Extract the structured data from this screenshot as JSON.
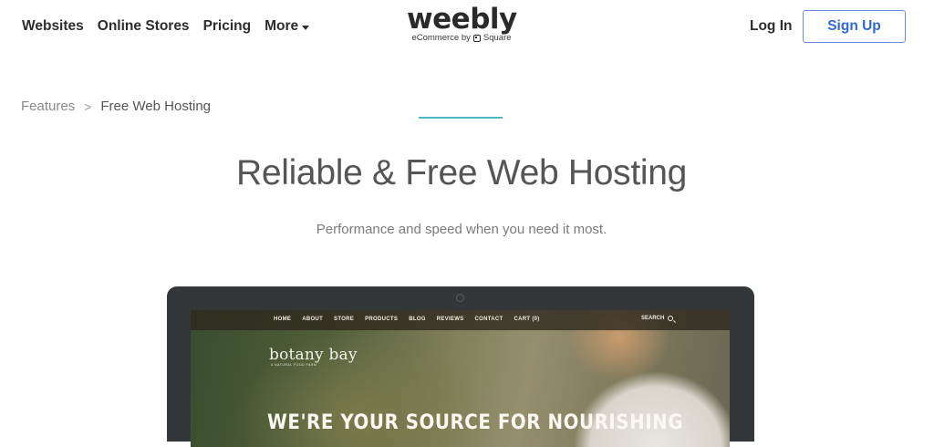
{
  "nav": {
    "items": [
      {
        "label": "Websites"
      },
      {
        "label": "Online Stores"
      },
      {
        "label": "Pricing"
      },
      {
        "label": "More"
      }
    ],
    "more_icon": "chevron-down-icon"
  },
  "logo": {
    "wordmark": "weebly",
    "tagline_prefix": "eCommerce by",
    "tagline_brand": "Square",
    "brand_icon": "square-logo-icon"
  },
  "header_actions": {
    "login_label": "Log In",
    "signup_label": "Sign Up"
  },
  "breadcrumb": {
    "parent": "Features",
    "separator": ">",
    "current": "Free Web Hosting"
  },
  "hero": {
    "title": "Reliable & Free Web Hosting",
    "subtitle": "Performance and speed when you need it most.",
    "accent_color": "#4cb8c4"
  },
  "mockup": {
    "nav_items": [
      {
        "label": "HOME"
      },
      {
        "label": "ABOUT"
      },
      {
        "label": "STORE"
      },
      {
        "label": "PRODUCTS"
      },
      {
        "label": "BLOG"
      },
      {
        "label": "REVIEWS"
      },
      {
        "label": "CONTACT"
      },
      {
        "label": "CART (0)"
      }
    ],
    "search_label": "SEARCH",
    "brand": "botany bay",
    "brand_tagline": "A NATURAL FOOD FARM",
    "headline": "WE'RE YOUR SOURCE FOR NOURISHING"
  },
  "colors": {
    "signup_border": "#6b8fd4",
    "signup_text": "#2f6ad1",
    "laptop_frame": "#34373a"
  }
}
